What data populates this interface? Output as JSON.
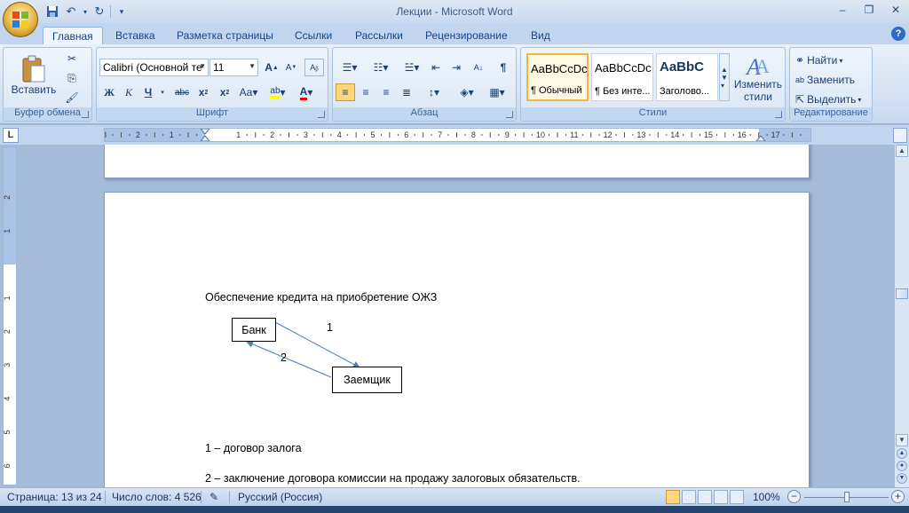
{
  "window": {
    "title": "Лекции - Microsoft Word"
  },
  "tabs": [
    {
      "label": "Главная"
    },
    {
      "label": "Вставка"
    },
    {
      "label": "Разметка страницы"
    },
    {
      "label": "Ссылки"
    },
    {
      "label": "Рассылки"
    },
    {
      "label": "Рецензирование"
    },
    {
      "label": "Вид"
    }
  ],
  "ribbon": {
    "clipboard": {
      "group_label": "Буфер обмена",
      "paste_label": "Вставить"
    },
    "font": {
      "group_label": "Шрифт",
      "font_name": "Calibri (Основной те",
      "font_size": "11"
    },
    "paragraph": {
      "group_label": "Абзац"
    },
    "styles": {
      "group_label": "Стили",
      "items": [
        {
          "sample": "AaBbCcDc",
          "name": "¶ Обычный"
        },
        {
          "sample": "AaBbCcDc",
          "name": "¶ Без инте..."
        },
        {
          "sample": "AaBbC",
          "name": "Заголово..."
        }
      ],
      "change_styles_line1": "Изменить",
      "change_styles_line2": "стили"
    },
    "editing": {
      "group_label": "Редактирование",
      "find": "Найти",
      "replace": "Заменить",
      "select": "Выделить"
    }
  },
  "ruler": {
    "h_labels": [
      "3",
      "2",
      "1",
      "1",
      "2",
      "3",
      "4",
      "5",
      "6",
      "7",
      "8",
      "9",
      "10",
      "11",
      "12",
      "13",
      "14",
      "15",
      "16",
      "17"
    ],
    "v_labels": [
      "2",
      "1",
      "1",
      "2",
      "3",
      "4",
      "5",
      "6"
    ]
  },
  "document": {
    "heading": "Обеспечение кредита на приобретение ОЖЗ",
    "diagram": {
      "box1": "Банк",
      "box2": "Заемщик",
      "arrow1_label": "1",
      "arrow2_label": "2"
    },
    "line1": "1 – договор залога",
    "line2": "2 – заключение договора комиссии на продажу залоговых обязательств."
  },
  "statusbar": {
    "page": "Страница: 13 из 24",
    "words": "Число слов: 4 526",
    "language": "Русский (Россия)",
    "zoom": "100%"
  },
  "colors": {
    "ribbon_text": "#15428b",
    "arrow": "#4a7ebb"
  }
}
